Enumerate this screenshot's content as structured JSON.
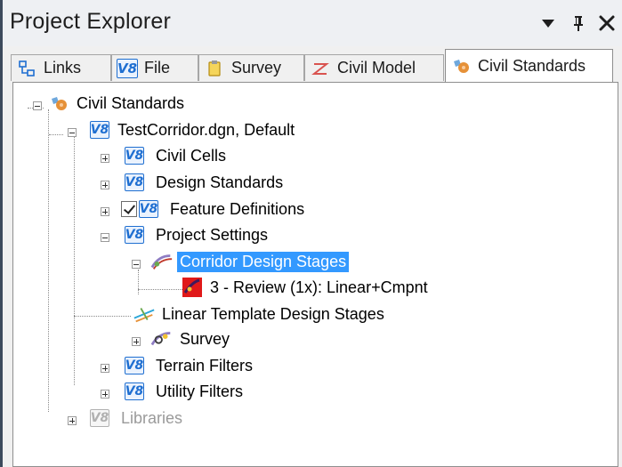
{
  "panel": {
    "title": "Project Explorer",
    "controls": {
      "dropdown_glyph": "▾",
      "pin_glyph": "ᵽ",
      "close_glyph": "✕"
    }
  },
  "tabs": [
    {
      "label": "Links",
      "icon": "links-icon"
    },
    {
      "label": "File",
      "icon": "v8-file-icon"
    },
    {
      "label": "Survey",
      "icon": "survey-icon"
    },
    {
      "label": "Civil Model",
      "icon": "civil-model-icon"
    },
    {
      "label": "Civil Standards",
      "icon": "civil-standards-icon",
      "active": true
    }
  ],
  "tree": {
    "root": {
      "label": "Civil Standards"
    },
    "file": {
      "label": "TestCorridor.dgn, Default",
      "badge": "V8"
    },
    "civil_cells": {
      "label": "Civil Cells",
      "badge": "V8"
    },
    "design_standards": {
      "label": "Design Standards",
      "badge": "V8"
    },
    "feature_definitions": {
      "label": "Feature Definitions",
      "badge": "V8",
      "checked": true
    },
    "project_settings": {
      "label": "Project Settings",
      "badge": "V8"
    },
    "corridor_design_stages": {
      "label": "Corridor Design Stages",
      "selected": true
    },
    "review_stage": {
      "label": "3 - Review (1x): Linear+Cmpnt"
    },
    "linear_template_stages": {
      "label": "Linear Template Design Stages"
    },
    "survey": {
      "label": "Survey"
    },
    "terrain_filters": {
      "label": "Terrain Filters",
      "badge": "V8"
    },
    "utility_filters": {
      "label": "Utility Filters",
      "badge": "V8"
    },
    "libraries": {
      "label": "Libraries",
      "badge": "V8",
      "disabled": true
    }
  },
  "colors": {
    "selection": "#3399ff",
    "v8_blue": "#1f6fd1",
    "disabled_text": "#9a9a9a"
  }
}
